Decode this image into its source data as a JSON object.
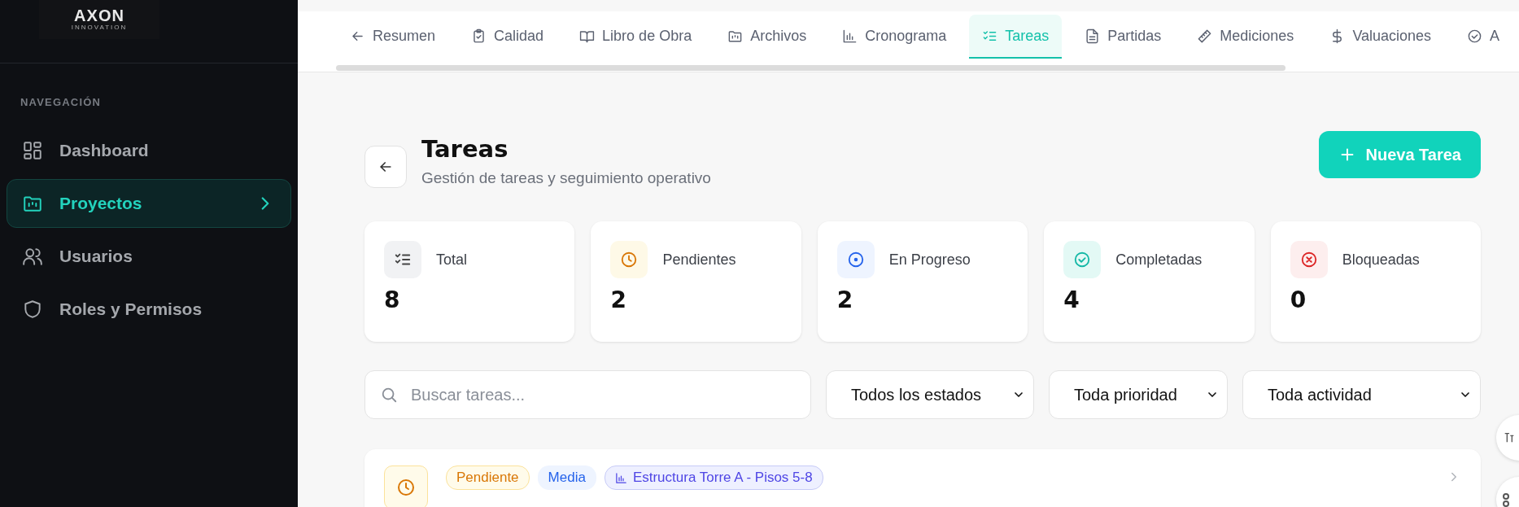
{
  "sidebar": {
    "logo": {
      "name": "AXON",
      "tagline": "INNOVATION"
    },
    "section_title": "NAVEGACIÓN",
    "items": [
      {
        "label": "Dashboard",
        "kind": "grid",
        "selected": false
      },
      {
        "label": "Proyectos",
        "kind": "folder",
        "selected": true
      },
      {
        "label": "Usuarios",
        "kind": "users",
        "selected": false
      },
      {
        "label": "Roles y Permisos",
        "kind": "shield",
        "selected": false
      }
    ]
  },
  "tabs": [
    {
      "label": "Resumen",
      "kind": "back",
      "selected": false
    },
    {
      "label": "Calidad",
      "kind": "clipboard",
      "selected": false
    },
    {
      "label": "Libro de Obra",
      "kind": "book",
      "selected": false
    },
    {
      "label": "Archivos",
      "kind": "folder",
      "selected": false
    },
    {
      "label": "Cronograma",
      "kind": "chart",
      "selected": false
    },
    {
      "label": "Tareas",
      "kind": "list",
      "selected": true
    },
    {
      "label": "Partidas",
      "kind": "file",
      "selected": false
    },
    {
      "label": "Mediciones",
      "kind": "ruler",
      "selected": false
    },
    {
      "label": "Valuaciones",
      "kind": "dollar",
      "selected": false
    },
    {
      "label": "A",
      "kind": "check",
      "selected": false
    }
  ],
  "header": {
    "title": "Tareas",
    "subtitle": "Gestión de tareas y seguimiento operativo",
    "new_button": "Nueva Tarea"
  },
  "stats": [
    {
      "label": "Total",
      "value": "8",
      "kind": "total"
    },
    {
      "label": "Pendientes",
      "value": "2",
      "kind": "pending"
    },
    {
      "label": "En Progreso",
      "value": "2",
      "kind": "progress"
    },
    {
      "label": "Completadas",
      "value": "4",
      "kind": "done"
    },
    {
      "label": "Bloqueadas",
      "value": "0",
      "kind": "blocked"
    }
  ],
  "filters": {
    "search": {
      "placeholder": "Buscar tareas..."
    },
    "selects": [
      "Todos los estados",
      "Toda prioridad",
      "Toda actividad"
    ]
  },
  "tasks": [
    {
      "badges": [
        {
          "label": "Pendiente",
          "kind": "status"
        },
        {
          "label": "Media",
          "kind": "priority"
        },
        {
          "label": "Estructura Torre A - Pisos 5-8",
          "kind": "activity"
        }
      ]
    }
  ]
}
